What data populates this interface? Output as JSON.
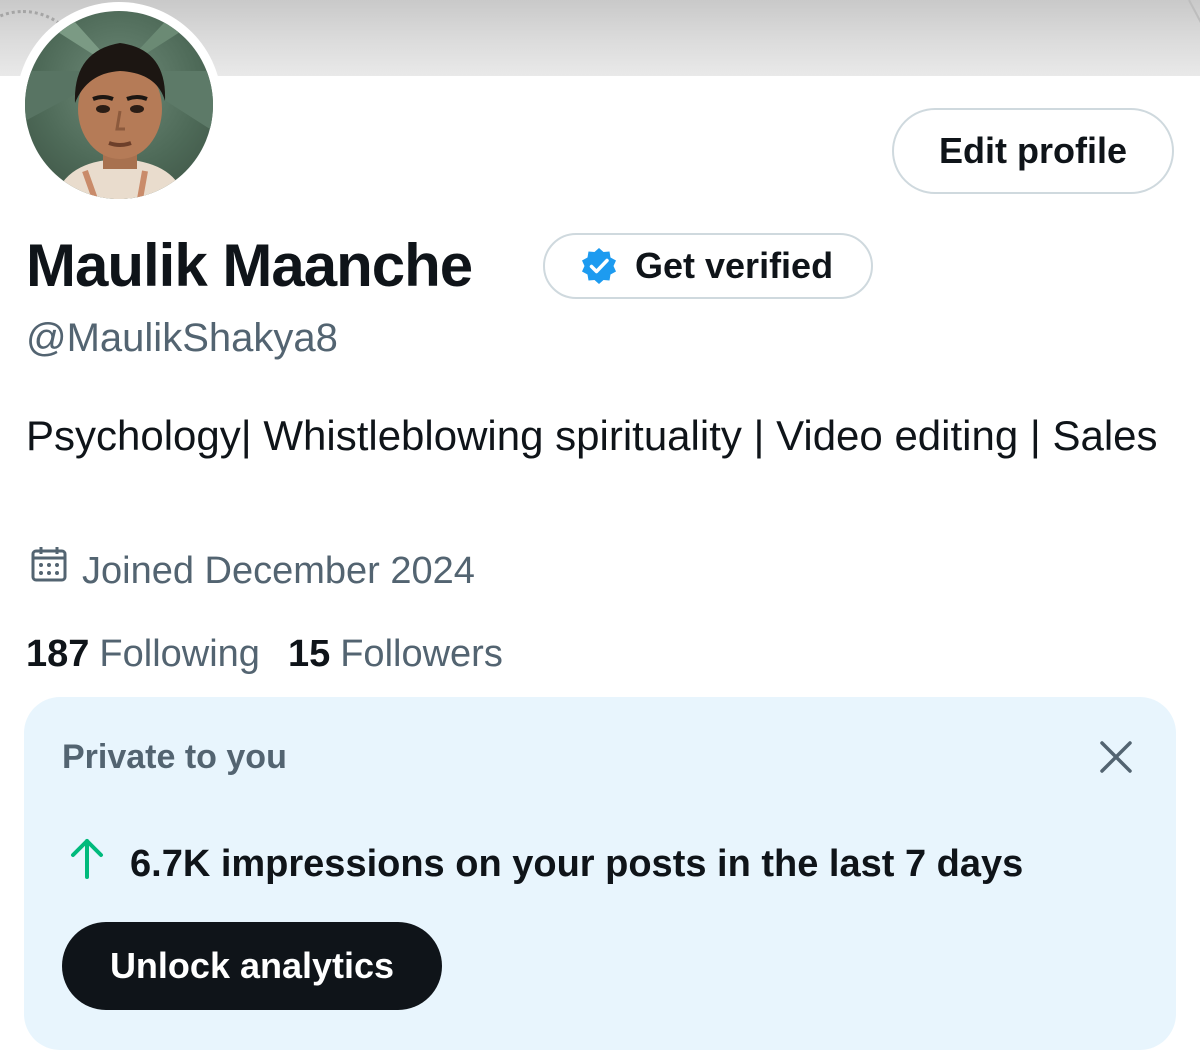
{
  "profile": {
    "display_name": "Maulik Maanche",
    "handle": "@MaulikShakya8",
    "bio": "Psychology| Whistleblowing spirituality | Video editing | Sales",
    "joined": "Joined December 2024",
    "edit_profile_label": "Edit profile",
    "get_verified_label": "Get verified",
    "following_count": "187",
    "following_label": "Following",
    "followers_count": "15",
    "followers_label": "Followers"
  },
  "private_card": {
    "title": "Private to you",
    "impressions_text": "6.7K impressions on your posts in the last 7 days",
    "unlock_label": "Unlock analytics"
  },
  "icons": {
    "verified": "verified-badge-icon",
    "calendar": "calendar-icon",
    "close": "close-icon",
    "trend": "arrow-up-icon"
  },
  "colors": {
    "verified_blue": "#1d9bf0",
    "trend_green": "#00ba7c",
    "secondary_text": "#536471",
    "card_bg": "#e8f5fd",
    "primary_button": "#0f1419"
  }
}
